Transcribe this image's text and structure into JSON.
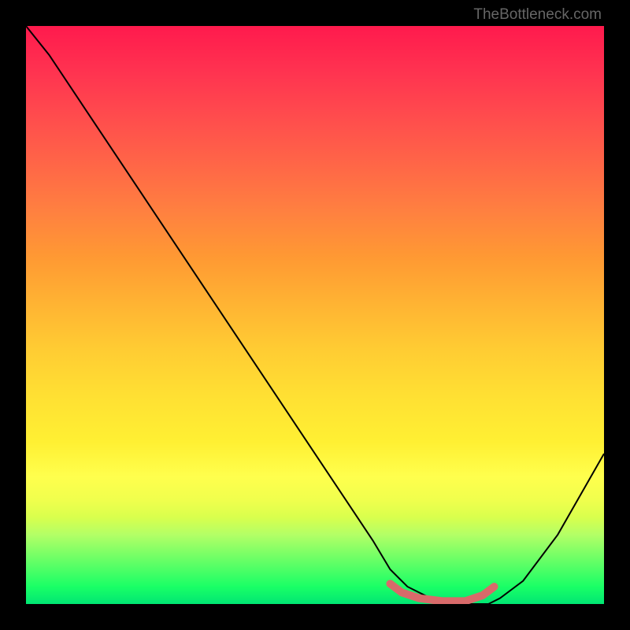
{
  "attribution": "TheBottleneck.com",
  "chart_data": {
    "type": "line",
    "title": "",
    "xlabel": "",
    "ylabel": "",
    "xlim": [
      0,
      100
    ],
    "ylim": [
      0,
      100
    ],
    "series": [
      {
        "name": "bottleneck-curve",
        "x": [
          0,
          4,
          10,
          20,
          30,
          40,
          50,
          60,
          63,
          66,
          70,
          74,
          78,
          80,
          82,
          86,
          92,
          100
        ],
        "y": [
          100,
          95,
          86,
          71,
          56,
          41,
          26,
          11,
          6,
          3,
          1,
          0,
          0,
          0,
          1,
          4,
          12,
          26
        ]
      },
      {
        "name": "optimal-zone-marker",
        "x": [
          63,
          65,
          68,
          72,
          76,
          79,
          81
        ],
        "y": [
          3.5,
          2,
          1,
          0.5,
          0.5,
          1.5,
          3
        ]
      }
    ],
    "colors": {
      "curve": "#000000",
      "marker": "#d86a6a"
    }
  }
}
